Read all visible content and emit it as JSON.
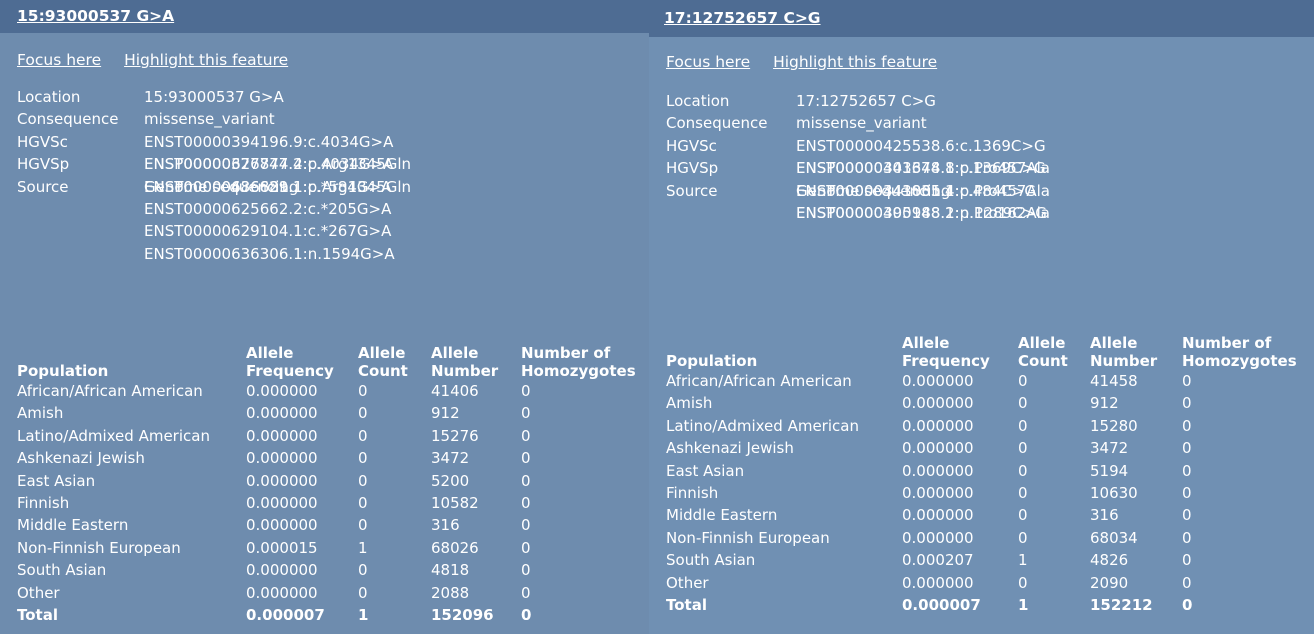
{
  "left": {
    "title": "15:93000537 G>A",
    "links": [
      "Focus here",
      "Highlight this feature"
    ],
    "info": [
      {
        "key": "Location",
        "values": [
          "15:93000537 G>A"
        ]
      },
      {
        "key": "Consequence",
        "values": [
          "missense_variant"
        ]
      },
      {
        "key": "HGVSc",
        "values": [
          "ENST00000394196.9:c.4034G>A",
          "ENST00000626874.2:c.4034G>A",
          "ENST00000636881.1:c.*584G>A",
          "ENST00000625662.2:c.*205G>A",
          "ENST00000629104.1:c.*267G>A",
          "ENST00000636306.1:n.1594G>A"
        ]
      },
      {
        "key": "HGVSp",
        "values": [
          "ENSP00000377747.4:p.Arg1345Gln",
          "ENSP00000486629.1:p.Arg1345Gln"
        ]
      },
      {
        "key": "Source",
        "values": [
          "Genome sequencing"
        ]
      }
    ],
    "headers": [
      "Population",
      "Allele Frequency",
      "Allele Count",
      "Allele Number",
      "Number of Homozygotes"
    ],
    "rows": [
      [
        "African/African American",
        "0.000000",
        "0",
        "41406",
        "0"
      ],
      [
        "Amish",
        "0.000000",
        "0",
        "912",
        "0"
      ],
      [
        "Latino/Admixed American",
        "0.000000",
        "0",
        "15276",
        "0"
      ],
      [
        "Ashkenazi Jewish",
        "0.000000",
        "0",
        "3472",
        "0"
      ],
      [
        "East Asian",
        "0.000000",
        "0",
        "5200",
        "0"
      ],
      [
        "Finnish",
        "0.000000",
        "0",
        "10582",
        "0"
      ],
      [
        "Middle Eastern",
        "0.000000",
        "0",
        "316",
        "0"
      ],
      [
        "Non-Finnish European",
        "0.000015",
        "1",
        "68026",
        "0"
      ],
      [
        "South Asian",
        "0.000000",
        "0",
        "4818",
        "0"
      ],
      [
        "Other",
        "0.000000",
        "0",
        "2088",
        "0"
      ]
    ],
    "total": [
      "Total",
      "0.000007",
      "1",
      "152096",
      "0"
    ]
  },
  "right": {
    "title": "17:12752657 C>G",
    "links": [
      "Focus here",
      "Highlight this feature"
    ],
    "info": [
      {
        "key": "Location",
        "values": [
          "17:12752657 C>G"
        ]
      },
      {
        "key": "Consequence",
        "values": [
          "missense_variant"
        ]
      },
      {
        "key": "HGVSc",
        "values": [
          "ENST00000425538.6:c.1369C>G",
          "ENST00000343344.8:c.1369C>G",
          "ENST00000443061.1:c.484C>G",
          "ENST00000395988.1:n.1289C>G"
        ]
      },
      {
        "key": "HGVSp",
        "values": [
          "ENSP00000401678.1:p.Pro457Ala",
          "ENSP00000341835.4:p.Pro457Ala",
          "ENSP00000400148.2:p.Pro162Ala"
        ]
      },
      {
        "key": "Source",
        "values": [
          "Genome sequencing"
        ]
      }
    ],
    "headers": [
      "Population",
      "Allele Frequency",
      "Allele Count",
      "Allele Number",
      "Number of Homozygotes"
    ],
    "rows": [
      [
        "African/African American",
        "0.000000",
        "0",
        "41458",
        "0"
      ],
      [
        "Amish",
        "0.000000",
        "0",
        "912",
        "0"
      ],
      [
        "Latino/Admixed American",
        "0.000000",
        "0",
        "15280",
        "0"
      ],
      [
        "Ashkenazi Jewish",
        "0.000000",
        "0",
        "3472",
        "0"
      ],
      [
        "East Asian",
        "0.000000",
        "0",
        "5194",
        "0"
      ],
      [
        "Finnish",
        "0.000000",
        "0",
        "10630",
        "0"
      ],
      [
        "Middle Eastern",
        "0.000000",
        "0",
        "316",
        "0"
      ],
      [
        "Non-Finnish European",
        "0.000000",
        "0",
        "68034",
        "0"
      ],
      [
        "South Asian",
        "0.000207",
        "1",
        "4826",
        "0"
      ],
      [
        "Other",
        "0.000000",
        "0",
        "2090",
        "0"
      ]
    ],
    "total": [
      "Total",
      "0.000007",
      "1",
      "152212",
      "0"
    ]
  }
}
